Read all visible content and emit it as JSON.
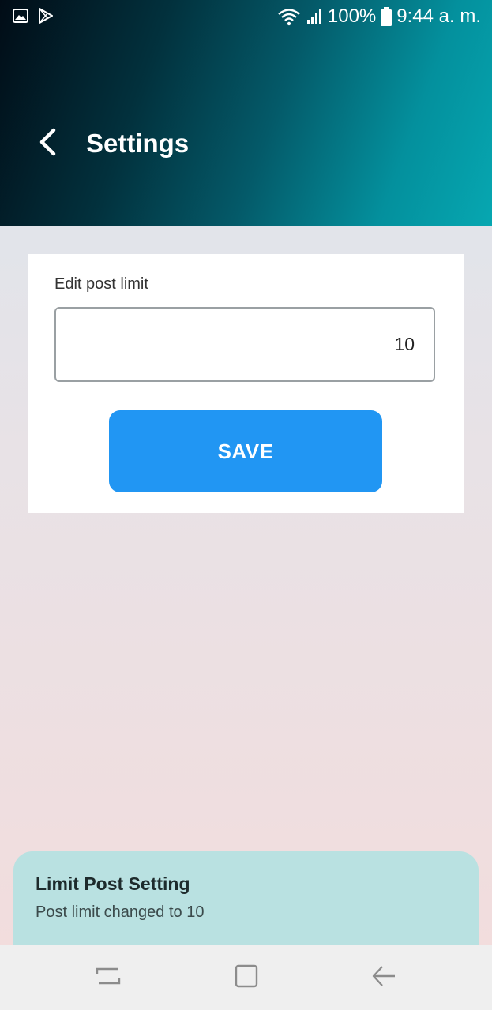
{
  "status_bar": {
    "battery": "100%",
    "time": "9:44 a. m.",
    "icons": [
      "image-icon",
      "play-store-icon",
      "wifi-icon",
      "signal-icon",
      "battery-icon"
    ]
  },
  "header": {
    "title": "Settings",
    "back_icon": "back-arrow-icon"
  },
  "card": {
    "field_label": "Edit post limit",
    "post_limit_value": "10",
    "save_label": "SAVE"
  },
  "snackbar": {
    "title": "Limit Post Setting",
    "message": "Post limit changed to 10"
  },
  "nav_bar": {
    "icons": [
      "recent-apps-icon",
      "home-icon",
      "back-icon"
    ]
  },
  "colors": {
    "accent": "#2196f3",
    "snackbar_bg": "#b9e1e1",
    "header_dark": "#010c16",
    "header_teal": "#06a7b1"
  }
}
